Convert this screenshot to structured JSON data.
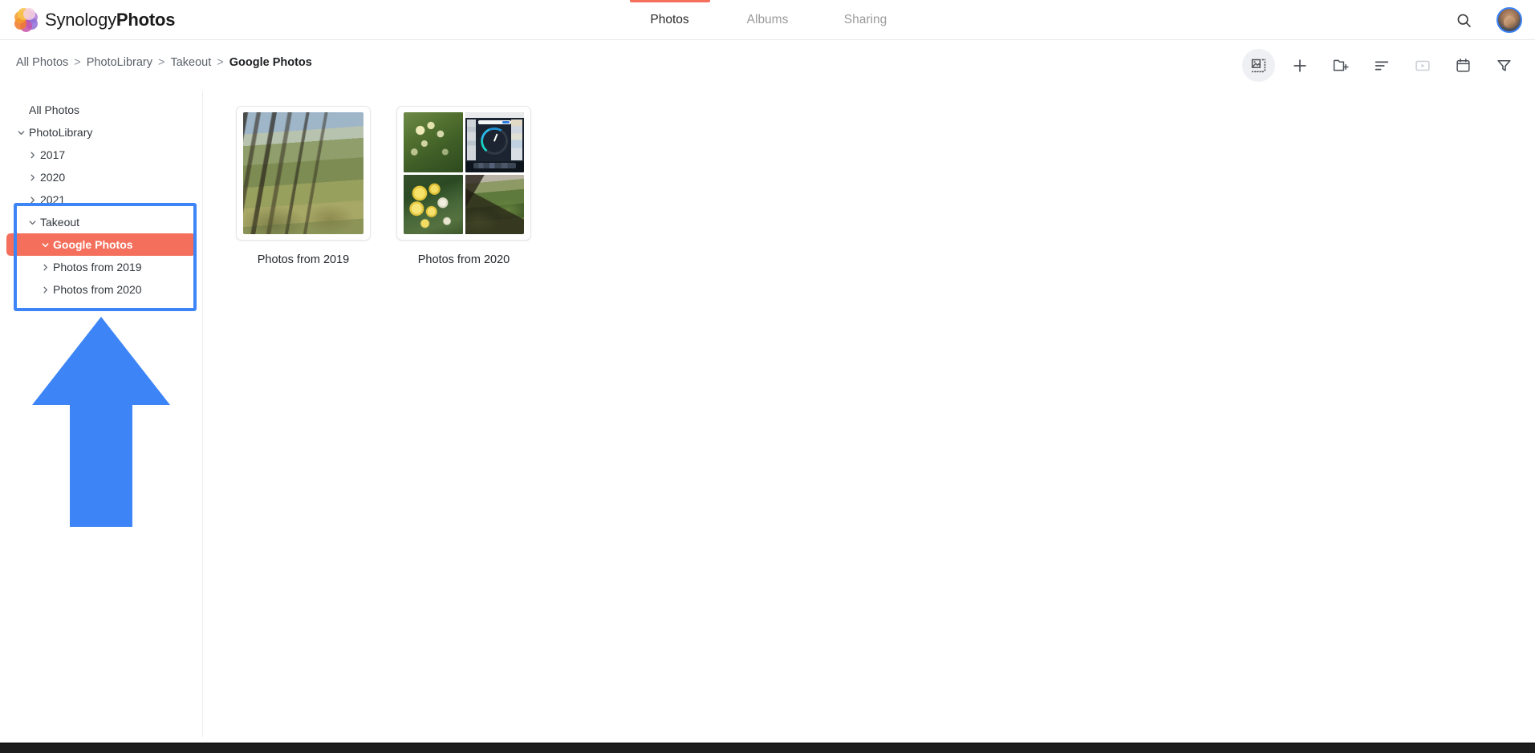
{
  "app": {
    "brand_primary": "Synology",
    "brand_secondary": "Photos",
    "logo_icon": "synology-photos-flower-logo"
  },
  "colors": {
    "accent": "#f4705c",
    "annotation_blue": "#3d85f7",
    "avatar_ring": "#3b82f6",
    "text_primary": "#1d1f22",
    "text_muted": "#9a9a9a",
    "divider": "#ececec"
  },
  "header": {
    "tabs": [
      {
        "label": "Photos",
        "active": true
      },
      {
        "label": "Albums",
        "active": false
      },
      {
        "label": "Sharing",
        "active": false
      }
    ],
    "search_icon": "search-icon",
    "avatar_alt": "user-avatar"
  },
  "breadcrumb": {
    "items": [
      {
        "label": "All Photos",
        "current": false
      },
      {
        "label": "PhotoLibrary",
        "current": false
      },
      {
        "label": "Takeout",
        "current": false
      },
      {
        "label": "Google Photos",
        "current": true
      }
    ],
    "separator": ">"
  },
  "toolbar": {
    "buttons": [
      {
        "name": "select-photos-button",
        "icon": "select-image-icon",
        "label": "Select",
        "state": "selected"
      },
      {
        "name": "add-button",
        "icon": "plus-icon",
        "label": "Add",
        "state": "normal"
      },
      {
        "name": "create-folder-button",
        "icon": "new-folder-icon",
        "label": "Create folder",
        "state": "normal"
      },
      {
        "name": "sort-button",
        "icon": "sort-icon",
        "label": "Sort",
        "state": "normal"
      },
      {
        "name": "slideshow-button",
        "icon": "slideshow-icon",
        "label": "Slideshow",
        "state": "disabled"
      },
      {
        "name": "calendar-button",
        "icon": "calendar-icon",
        "label": "Timeline",
        "state": "normal"
      },
      {
        "name": "filter-button",
        "icon": "filter-icon",
        "label": "Filter",
        "state": "normal"
      }
    ]
  },
  "sidebar": {
    "items": [
      {
        "label": "All Photos",
        "level": 0,
        "twisty": "none",
        "selected": false
      },
      {
        "label": "PhotoLibrary",
        "level": 1,
        "twisty": "down",
        "selected": false
      },
      {
        "label": "2017",
        "level": 2,
        "twisty": "right",
        "selected": false
      },
      {
        "label": "2020",
        "level": 2,
        "twisty": "right",
        "selected": false
      },
      {
        "label": "2021",
        "level": 2,
        "twisty": "right",
        "selected": false
      },
      {
        "label": "Takeout",
        "level": 2,
        "twisty": "down",
        "selected": false
      },
      {
        "label": "Google Photos",
        "level": 3,
        "twisty": "down",
        "selected": true
      },
      {
        "label": "Photos from 2019",
        "level": 3,
        "twisty": "right",
        "selected": false
      },
      {
        "label": "Photos from 2020",
        "level": 3,
        "twisty": "right",
        "selected": false
      }
    ]
  },
  "annotations": {
    "highlight_box": "blue-rectangle-around-takeout-subtree",
    "arrow": "blue-up-arrow"
  },
  "main": {
    "folders": [
      {
        "caption": "Photos from 2019",
        "thumb_type": "single",
        "tiles": [
          "ph-trees"
        ]
      },
      {
        "caption": "Photos from 2020",
        "thumb_type": "quad",
        "tiles": [
          "ph-honeysuckle",
          "ph-dashboard",
          "ph-roses",
          "ph-garden"
        ]
      }
    ]
  }
}
